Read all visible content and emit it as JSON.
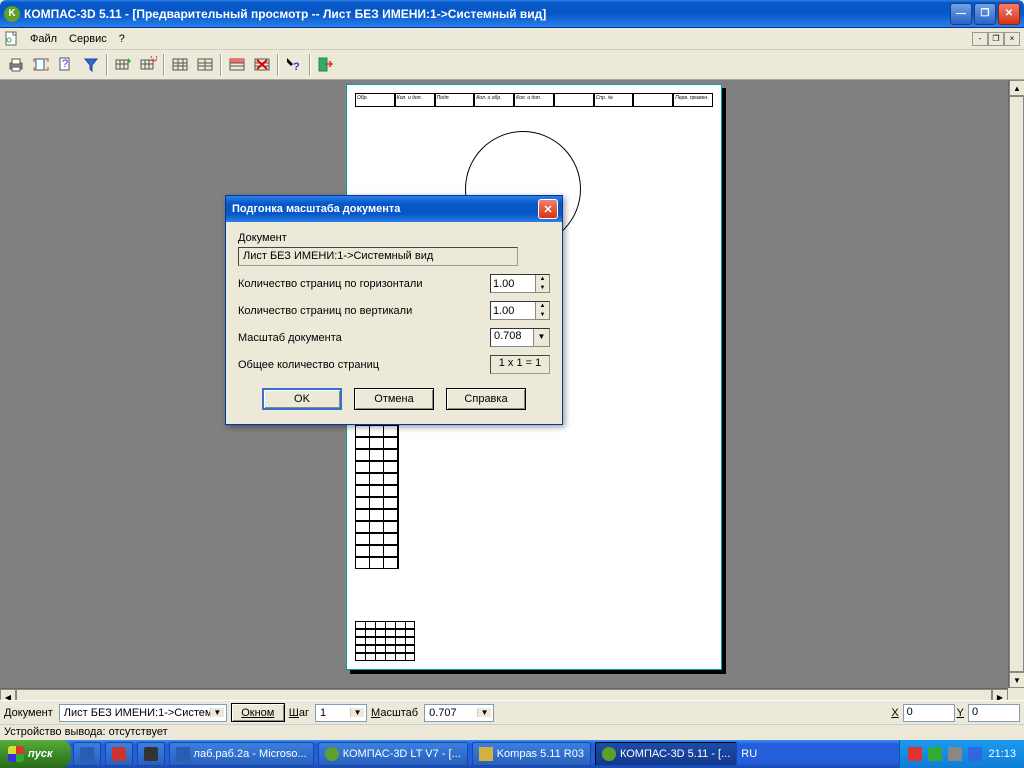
{
  "window": {
    "title": "КОМПАС-3D 5.11 - [Предварительный просмотр -- Лист БЕЗ ИМЕНИ:1->Системный вид]"
  },
  "menu": {
    "file": "Файл",
    "service": "Сервис",
    "help": "?"
  },
  "toolbar_icons": [
    "print",
    "fit",
    "page-options",
    "funnel",
    "grid-a",
    "grid-b",
    "grid-c",
    "table-a",
    "table-b",
    "table-x",
    "help-arrow",
    "switch"
  ],
  "dialog": {
    "title": "Подгонка масштаба документа",
    "doc_label": "Документ",
    "doc_value": "Лист БЕЗ ИМЕНИ:1->Системный вид",
    "pages_h_label": "Количество страниц по горизонтали",
    "pages_h_value": "1.00",
    "pages_v_label": "Количество страниц по вертикали",
    "pages_v_value": "1.00",
    "scale_label": "Масштаб документа",
    "scale_value": "0.708",
    "total_label": "Общее количество страниц",
    "total_value": "1 x 1 = 1",
    "ok": "OK",
    "cancel": "Отмена",
    "help": "Справка"
  },
  "ctrl": {
    "doc_label": "Документ",
    "doc_value": "Лист БЕЗ ИМЕНИ:1->Систем",
    "window_label": "Окном",
    "step_label": "Шаг",
    "step_letter": "Ш",
    "step_value": "1",
    "scale_label": "Масштаб",
    "scale_letter": "М",
    "scale_value": "0.707",
    "x_label": "X",
    "x_value": "0",
    "y_label": "Y",
    "y_value": "0"
  },
  "status": "Устройство вывода: отсутствует",
  "taskbar": {
    "start": "пуск",
    "items": [
      {
        "label": "лаб.раб.2a - Microso...",
        "icon_color": "#2a5db0"
      },
      {
        "label": "КОМПАС-3D LT V7 - [...",
        "icon_color": "#5fa02a"
      },
      {
        "label": "Kompas 5.11 R03",
        "icon_color": "#d4b040"
      },
      {
        "label": "КОМПАС-3D 5.11 - [...",
        "icon_color": "#5fa02a",
        "active": true
      }
    ],
    "lang": "RU",
    "time": "21:13"
  },
  "page_header_cells": [
    "Обр.",
    "Кол. и доп.",
    "Подп.",
    "Кол. и обр.",
    "Кол. и доп.",
    "",
    "Спр. №",
    "",
    "Перв. примен."
  ]
}
